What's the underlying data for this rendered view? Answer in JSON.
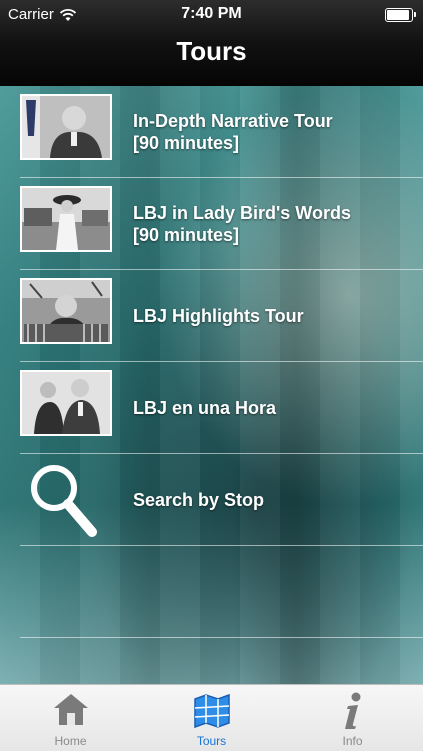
{
  "status_bar": {
    "carrier": "Carrier",
    "time": "7:40 PM"
  },
  "navbar": {
    "title": "Tours"
  },
  "tours": [
    {
      "line1": "In-Depth Narrative Tour",
      "line2": "[90 minutes]"
    },
    {
      "line1": "LBJ in Lady Bird's Words",
      "line2": "[90 minutes]"
    },
    {
      "line1": "LBJ Highlights Tour",
      "line2": ""
    },
    {
      "line1": "LBJ en una Hora",
      "line2": ""
    }
  ],
  "search": {
    "label": "Search by Stop"
  },
  "tabbar": {
    "items": [
      {
        "label": "Home",
        "icon": "home-icon"
      },
      {
        "label": "Tours",
        "icon": "map-icon",
        "active": true
      },
      {
        "label": "Info",
        "icon": "info-icon"
      }
    ]
  },
  "colors": {
    "accent": "#1a74d6",
    "teal": "#2f7c7d"
  }
}
